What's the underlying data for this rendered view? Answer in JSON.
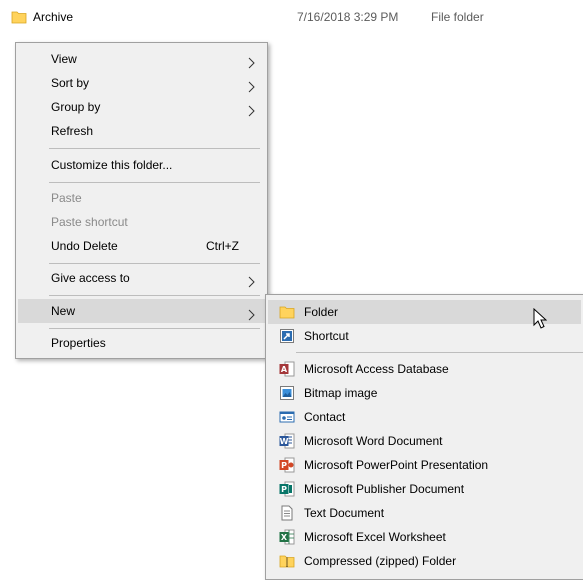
{
  "file": {
    "name": "Archive",
    "date": "7/16/2018 3:29 PM",
    "type": "File folder"
  },
  "context_menu": {
    "view": "View",
    "sort_by": "Sort by",
    "group_by": "Group by",
    "refresh": "Refresh",
    "customize": "Customize this folder...",
    "paste": "Paste",
    "paste_shortcut": "Paste shortcut",
    "undo_delete": "Undo Delete",
    "undo_delete_shortcut": "Ctrl+Z",
    "give_access": "Give access to",
    "new": "New",
    "properties": "Properties"
  },
  "new_submenu": {
    "folder": "Folder",
    "shortcut": "Shortcut",
    "access_db": "Microsoft Access Database",
    "bitmap": "Bitmap image",
    "contact": "Contact",
    "word": "Microsoft Word Document",
    "powerpoint": "Microsoft PowerPoint Presentation",
    "publisher": "Microsoft Publisher Document",
    "text": "Text Document",
    "excel": "Microsoft Excel Worksheet",
    "zip": "Compressed (zipped) Folder"
  },
  "icons": {
    "folder": "folder-icon",
    "shortcut": "shortcut-icon",
    "access": "access-icon",
    "bitmap": "bitmap-icon",
    "contact": "contact-icon",
    "word": "word-icon",
    "powerpoint": "powerpoint-icon",
    "publisher": "publisher-icon",
    "text": "text-document-icon",
    "excel": "excel-icon",
    "zip": "zip-folder-icon"
  },
  "colors": {
    "menu_bg": "#f0f0f0",
    "hover": "#d9d9d9",
    "disabled_text": "#8a8a8a",
    "folder": "#ffd35c",
    "access": "#a4373a",
    "word": "#2b579a",
    "powerpoint": "#d24726",
    "publisher": "#077568",
    "excel": "#217346"
  }
}
